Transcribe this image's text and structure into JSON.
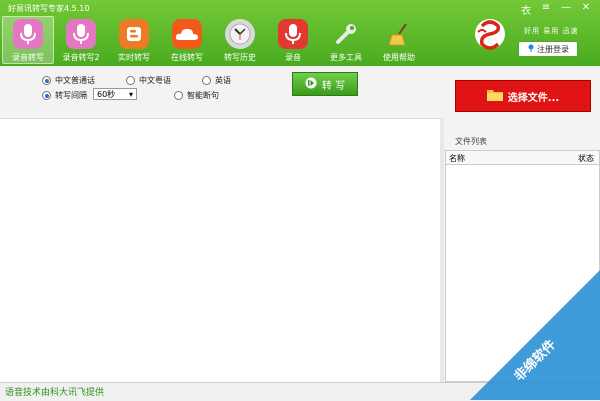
{
  "app": {
    "title": "好易讯转写专家4.5.10"
  },
  "window_controls": {
    "skin": "衣",
    "menu": "≡",
    "minimize": "—",
    "close": "✕"
  },
  "toolbar": {
    "items": [
      {
        "label": "录音转写",
        "icon": "microphone-icon",
        "color": "#e477c2"
      },
      {
        "label": "录音转写2",
        "icon": "microphone-icon",
        "color": "#e477c2"
      },
      {
        "label": "实时转写",
        "icon": "blogger-icon",
        "color": "#ef7a25"
      },
      {
        "label": "在线转写",
        "icon": "cloud-icon",
        "color": "#f25a1a"
      },
      {
        "label": "转写历史",
        "icon": "clock-icon",
        "color": "#cfcfcf"
      },
      {
        "label": "录音",
        "icon": "microphone-icon",
        "color": "#e2382f"
      },
      {
        "label": "更多工具",
        "icon": "wrench-icon",
        "color": "#dfe8df"
      },
      {
        "label": "使用帮助",
        "icon": "broom-icon",
        "color": "#f1c84a"
      }
    ]
  },
  "brand": {
    "slogan": "好用 易用 迅速",
    "login_label": "注册登录",
    "color": "#d8261a"
  },
  "options": {
    "lang_mandarin": "中文普通话",
    "lang_cantonese": "中文粤语",
    "lang_english": "英语",
    "mode_interval": "转写间隔",
    "interval_value": "60秒",
    "smart_break": "智能断句",
    "convert_label": "转 写"
  },
  "right_panel": {
    "select_file_label": "选择文件...",
    "file_list_title": "文件列表",
    "col_name": "名称",
    "col_status": "状态"
  },
  "statusbar": {
    "text": "语音技术由科大讯飞提供"
  },
  "watermark": {
    "text": "非绵软件"
  }
}
